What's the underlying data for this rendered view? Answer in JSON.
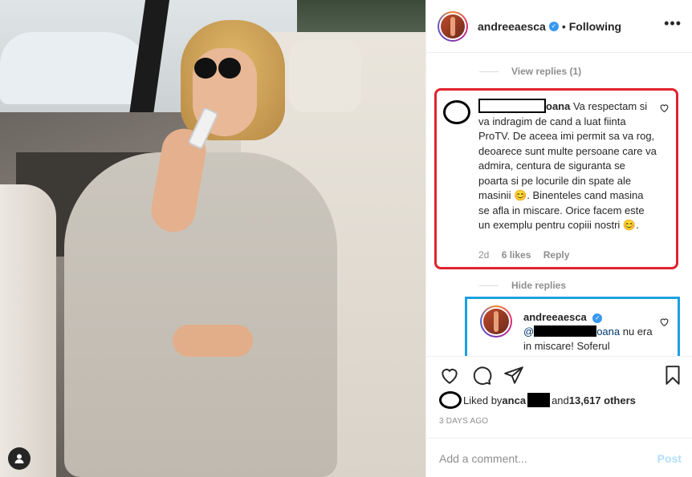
{
  "header": {
    "username": "andreeaesca",
    "separator": "•",
    "follow_status": "Following",
    "more": "•••"
  },
  "thread": {
    "view_replies": "View replies (1)",
    "comment": {
      "name_suffix": "oana",
      "text": " Va respectam si va indragim de cand a luat fiinta ProTV. De aceea imi permit sa va rog, deoarece sunt multe persoane care va admira, centura de siguranta se poarta si pe locurile din spate ale masinii 😊. Binenteles cand masina se afla in miscare. Orice facem este un exemplu pentru copiii nostri 😊.",
      "age": "2d",
      "likes": "6 likes",
      "reply": "Reply"
    },
    "hide_replies": "Hide replies",
    "reply": {
      "username": "andreeaesca",
      "mention_prefix": "@",
      "mention_suffix": "oana",
      "text": " nu era in miscare! Soferul"
    }
  },
  "likes": {
    "prefix": "Liked by ",
    "user": "anca",
    "and": " and ",
    "others": "13,617 others"
  },
  "timestamp": "3 DAYS AGO",
  "add_comment": {
    "placeholder": "Add a comment...",
    "post": "Post"
  },
  "colors": {
    "highlight_comment": "#e0222e",
    "highlight_reply": "#1ba1e2",
    "verified": "#3897f0",
    "post_disabled": "#b2dffc"
  }
}
